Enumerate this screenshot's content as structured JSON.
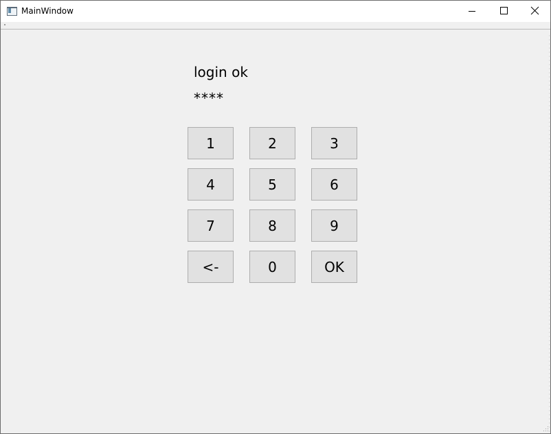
{
  "window": {
    "title": "MainWindow"
  },
  "titlebar_buttons": {
    "minimize_icon": "minimize-icon",
    "maximize_icon": "maximize-icon",
    "close_icon": "close-icon"
  },
  "login": {
    "status_text": "login ok",
    "pin_masked": "****"
  },
  "keypad": {
    "keys": [
      {
        "label": "1"
      },
      {
        "label": "2"
      },
      {
        "label": "3"
      },
      {
        "label": "4"
      },
      {
        "label": "5"
      },
      {
        "label": "6"
      },
      {
        "label": "7"
      },
      {
        "label": "8"
      },
      {
        "label": "9"
      },
      {
        "label": "<-"
      },
      {
        "label": "0"
      },
      {
        "label": "OK"
      }
    ]
  },
  "colors": {
    "window_background": "#f0f0f0",
    "titlebar_background": "#ffffff",
    "key_background": "#e1e1e1",
    "key_border": "#adadad"
  }
}
